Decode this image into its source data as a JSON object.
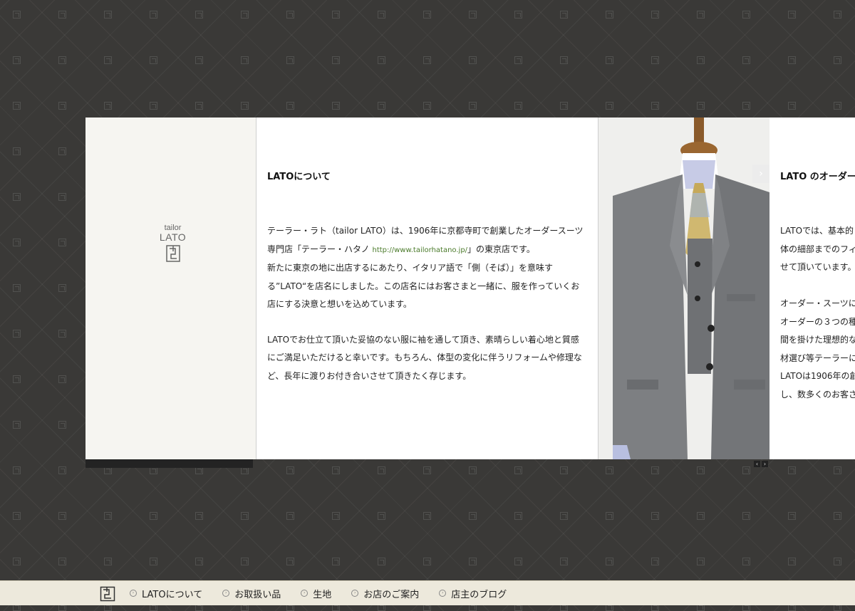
{
  "logo": {
    "line1": "tailor",
    "line2": "LATO"
  },
  "about": {
    "title": "LATOについて",
    "p1_a": "テーラー・ラト（tailor LATO）は、1906年に京都寺町で創業したオーダースーツ専門店「テーラー・ハタノ",
    "p1_link": "http://www.tailorhatano.jp/",
    "p1_b": "」の東京店です。",
    "p1_c": "新たに東京の地に出店するにあたり、イタリア語で「側（そば）」を意味する”LATO“を店名にしました。この店名にはお客さまと一緒に、服を作っていくお店にする決意と想いを込めています。",
    "p2": "LATOでお仕立て頂いた妥協のない服に袖を通して頂き、素晴らしい着心地と質感にご満足いただけると幸いです。もちろん、体型の変化に伴うリフォームや修理など、長年に渡りお付き合いさせて頂きたく存じます。"
  },
  "order": {
    "title": "LATO のオーダー",
    "lines": [
      "LATOでは、基本的",
      "体の細部までのフィ",
      "せて頂いています。",
      "",
      "オーダー・スーツに",
      "オーダーの３つの種",
      "間を掛けた理想的な",
      "材選び等テーラーに",
      "LATOは1906年の創",
      "し、数多くのお客さ"
    ]
  },
  "gallery": {
    "next_symbol": "›",
    "prev_symbol": "‹"
  },
  "footer": {
    "nav": [
      {
        "label": "LATOについて"
      },
      {
        "label": "お取扱い品"
      },
      {
        "label": "生地"
      },
      {
        "label": "お店のご案内"
      },
      {
        "label": "店主のブログ"
      }
    ]
  },
  "colors": {
    "background": "#3a3937",
    "footer": "#ede9dc",
    "link": "#4a7a2a"
  }
}
